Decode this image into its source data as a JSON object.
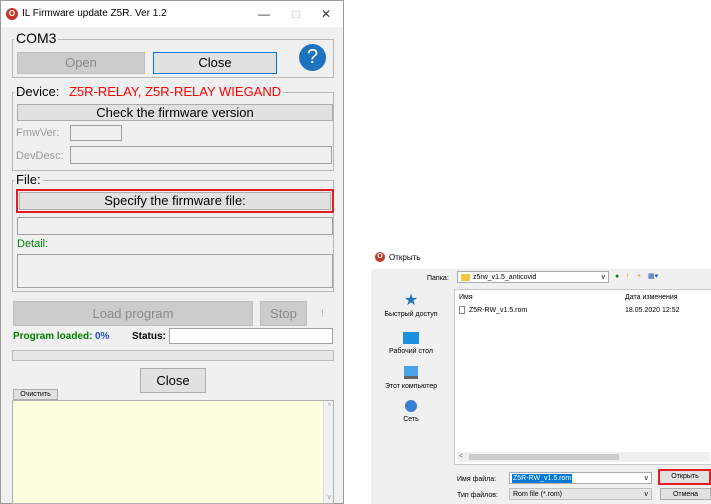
{
  "main_window": {
    "title": "IL Firmware update Z5R. Ver 1.2",
    "logo_glyph": "O",
    "controls": {
      "minimize": "—",
      "maximize": "□",
      "close": "✕"
    },
    "port_group": {
      "label": "COM3",
      "open_label": "Open",
      "close_label": "Close",
      "help_glyph": "?"
    },
    "device_group": {
      "label_prefix": "Device:",
      "device_name": "Z5R-RELAY, Z5R-RELAY WIEGAND",
      "check_label": "Check the firmware version",
      "fmwver_label": "FmwVer:",
      "fmwver_value": "",
      "devdesc_label": "DevDesc:",
      "devdesc_value": ""
    },
    "file_group": {
      "label": "File:",
      "specify_label": "Specify the firmware file:",
      "path_value": "",
      "detail_label": "Detail:",
      "detail_value": ""
    },
    "load_label": "Load program",
    "stop_label": "Stop",
    "dot_glyph": "!",
    "program_loaded_label": "Program loaded:",
    "percent": "0%",
    "status_label": "Status:",
    "status_value": "",
    "progress": 0,
    "close_label": "Close",
    "clear_label": "Очистить",
    "log_value": ""
  },
  "open_dialog": {
    "title": "Открыть",
    "folder_label": "Папка:",
    "folder_value": "z5rw_v1.5_anticovid",
    "col_name": "Имя",
    "col_date": "Дата изменения",
    "files": [
      {
        "name": "Z5R-RW_v1.5.rom",
        "date": "18.05.2020 12:52"
      }
    ],
    "places": [
      "Быстрый доступ",
      "Рабочий стол",
      "Этот компьютер",
      "Сеть"
    ],
    "filename_label": "Имя файла:",
    "filename_value": "Z5R-RW_v1.5.rom",
    "filetype_label": "Тип файлов:",
    "filetype_value": "Rom file (*.rom)",
    "open_label": "Открыть",
    "cancel_label": "Отмена"
  },
  "colors": {
    "accent_red": "#e31b23",
    "device_red": "#ff0000",
    "detail_green": "#008000",
    "help_blue": "#1e73be",
    "log_bg": "#ffffe0",
    "select_blue": "#0078d7"
  }
}
